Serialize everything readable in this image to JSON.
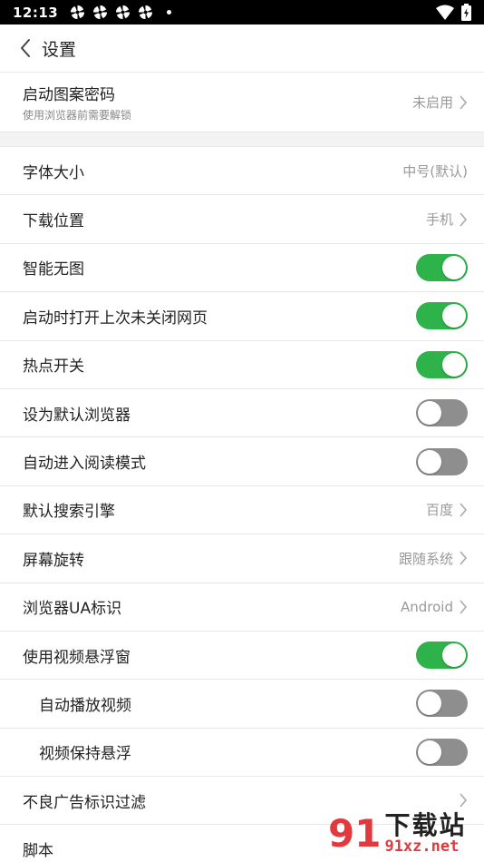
{
  "status_bar": {
    "time": "12:13",
    "notification_icons": [
      "pinwheel-icon",
      "pinwheel-icon",
      "pinwheel-icon",
      "pinwheel-icon"
    ],
    "right_icons": [
      "wifi-icon",
      "battery-charging-icon"
    ]
  },
  "header": {
    "title": "设置"
  },
  "pattern_lock": {
    "label": "启动图案密码",
    "sublabel": "使用浏览器前需要解锁",
    "value": "未启用"
  },
  "settings": [
    {
      "id": "font-size",
      "label": "字体大小",
      "value": "中号(默认)",
      "type": "value"
    },
    {
      "id": "download-location",
      "label": "下载位置",
      "value": "手机",
      "type": "chevron"
    },
    {
      "id": "smart-no-image",
      "label": "智能无图",
      "type": "toggle",
      "on": true
    },
    {
      "id": "restore-tabs",
      "label": "启动时打开上次未关闭网页",
      "type": "toggle",
      "on": true
    },
    {
      "id": "hotspot-switch",
      "label": "热点开关",
      "type": "toggle",
      "on": true
    },
    {
      "id": "default-browser",
      "label": "设为默认浏览器",
      "type": "toggle",
      "on": false
    },
    {
      "id": "auto-reader-mode",
      "label": "自动进入阅读模式",
      "type": "toggle",
      "on": false
    },
    {
      "id": "default-search-engine",
      "label": "默认搜索引擎",
      "value": "百度",
      "type": "chevron"
    },
    {
      "id": "screen-rotation",
      "label": "屏幕旋转",
      "value": "跟随系统",
      "type": "chevron"
    },
    {
      "id": "browser-ua",
      "label": "浏览器UA标识",
      "value": "Android",
      "type": "chevron"
    },
    {
      "id": "floating-video",
      "label": "使用视频悬浮窗",
      "type": "toggle",
      "on": true
    },
    {
      "id": "autoplay-video",
      "label": "自动播放视频",
      "type": "toggle",
      "on": false,
      "sub": true
    },
    {
      "id": "keep-video-floating",
      "label": "视频保持悬浮",
      "type": "toggle",
      "on": false,
      "sub": true
    },
    {
      "id": "ad-filter",
      "label": "不良广告标识过滤",
      "value": "",
      "type": "chevron"
    },
    {
      "id": "script",
      "label": "脚本",
      "type": "none"
    }
  ],
  "watermark": {
    "number": "91",
    "cn": "下载站",
    "en": "91xz.net"
  },
  "colors": {
    "toggle_on": "#2db34a",
    "toggle_off": "#8e8e8e",
    "watermark_red": "#e03a3e"
  }
}
